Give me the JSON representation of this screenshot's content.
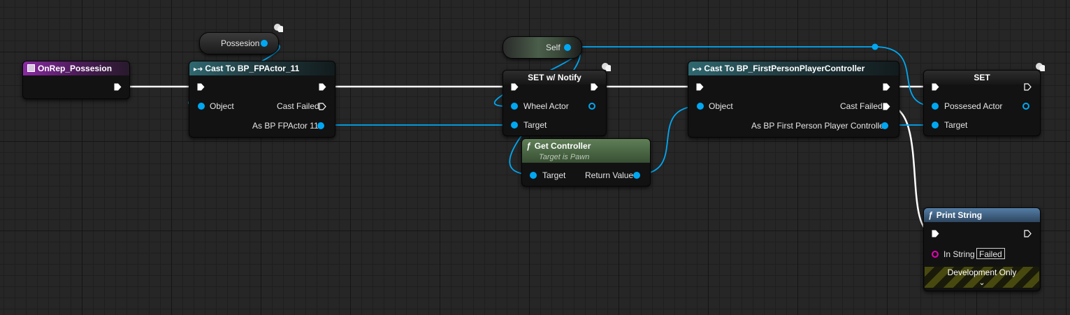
{
  "nodes": {
    "event": {
      "title": "OnRep_Possesion"
    },
    "cast1": {
      "title": "Cast To BP_FPActor_11",
      "object": "Object",
      "cast_failed": "Cast Failed",
      "as_out": "As BP FPActor 11"
    },
    "possesion_var": {
      "label": "Possesion"
    },
    "self_var": {
      "label": "Self"
    },
    "set_notify": {
      "title": "SET w/ Notify",
      "wheel_actor": "Wheel Actor",
      "target": "Target"
    },
    "get_controller": {
      "title": "Get Controller",
      "subtitle": "Target is Pawn",
      "target": "Target",
      "return_value": "Return Value"
    },
    "cast2": {
      "title": "Cast To BP_FirstPersonPlayerController",
      "object": "Object",
      "cast_failed": "Cast Failed",
      "as_out": "As BP First Person Player Controller"
    },
    "set2": {
      "title": "SET",
      "possesed_actor": "Possesed Actor",
      "target": "Target"
    },
    "print": {
      "title": "Print String",
      "in_string": "In String",
      "in_string_value": "Failed",
      "dev_only": "Development Only"
    }
  },
  "icons": {
    "function_glyph": "ƒ",
    "cast_glyph": "▸➜",
    "chevron": "⌄"
  },
  "colors": {
    "object_pin": "#00a8f3",
    "string_pin": "#e600b8",
    "exec_wire": "#ffffff",
    "cast_header": "#2f6870",
    "event_header": "#8a2aa3",
    "function_header": "#547da5",
    "pure_header": "#5f7f57"
  }
}
